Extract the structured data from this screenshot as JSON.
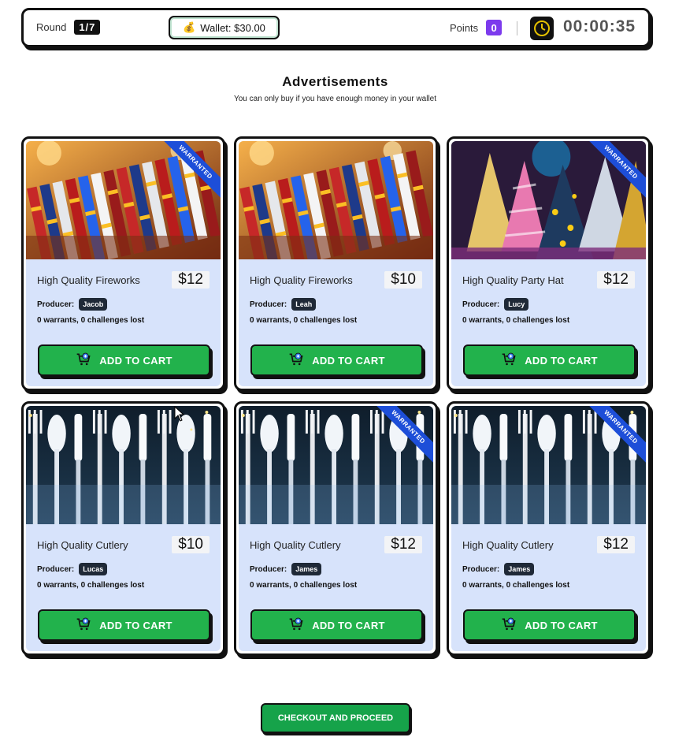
{
  "header": {
    "round_label": "Round",
    "round_value": "1/7",
    "wallet_icon": "money-bag-icon",
    "wallet_text": "Wallet: $30.00",
    "points_label": "Points",
    "points_value": "0",
    "clock_icon": "clock-icon",
    "timer": "00:00:35"
  },
  "page": {
    "title": "Advertisements",
    "subtitle": "You can only buy if you have enough money in your wallet"
  },
  "badges": {
    "warranted": "WARRANTED"
  },
  "cards": [
    {
      "name": "High Quality Fireworks",
      "price": "$12",
      "producer_label": "Producer:",
      "producer": "Jacob",
      "stats": "0 warrants, 0 challenges lost",
      "button": "ADD TO CART",
      "image": "fireworks",
      "warranted": true
    },
    {
      "name": "High Quality Fireworks",
      "price": "$10",
      "producer_label": "Producer:",
      "producer": "Leah",
      "stats": "0 warrants, 0 challenges lost",
      "button": "ADD TO CART",
      "image": "fireworks",
      "warranted": false
    },
    {
      "name": "High Quality Party Hat",
      "price": "$12",
      "producer_label": "Producer:",
      "producer": "Lucy",
      "stats": "0 warrants, 0 challenges lost",
      "button": "ADD TO CART",
      "image": "party-hat",
      "warranted": true
    },
    {
      "name": "High Quality Cutlery",
      "price": "$10",
      "producer_label": "Producer:",
      "producer": "Lucas",
      "stats": "0 warrants, 0 challenges lost",
      "button": "ADD TO CART",
      "image": "cutlery",
      "warranted": false
    },
    {
      "name": "High Quality Cutlery",
      "price": "$12",
      "producer_label": "Producer:",
      "producer": "James",
      "stats": "0 warrants, 0 challenges lost",
      "button": "ADD TO CART",
      "image": "cutlery",
      "warranted": true
    },
    {
      "name": "High Quality Cutlery",
      "price": "$12",
      "producer_label": "Producer:",
      "producer": "James",
      "stats": "0 warrants, 0 challenges lost",
      "button": "ADD TO CART",
      "image": "cutlery",
      "warranted": true
    }
  ],
  "checkout": {
    "label": "CHECKOUT AND PROCEED"
  },
  "colors": {
    "accent_green": "#22b24c",
    "card_bg": "#d7e3fb",
    "ribbon_blue": "#1d4ed8",
    "points_purple": "#7c3aed"
  }
}
